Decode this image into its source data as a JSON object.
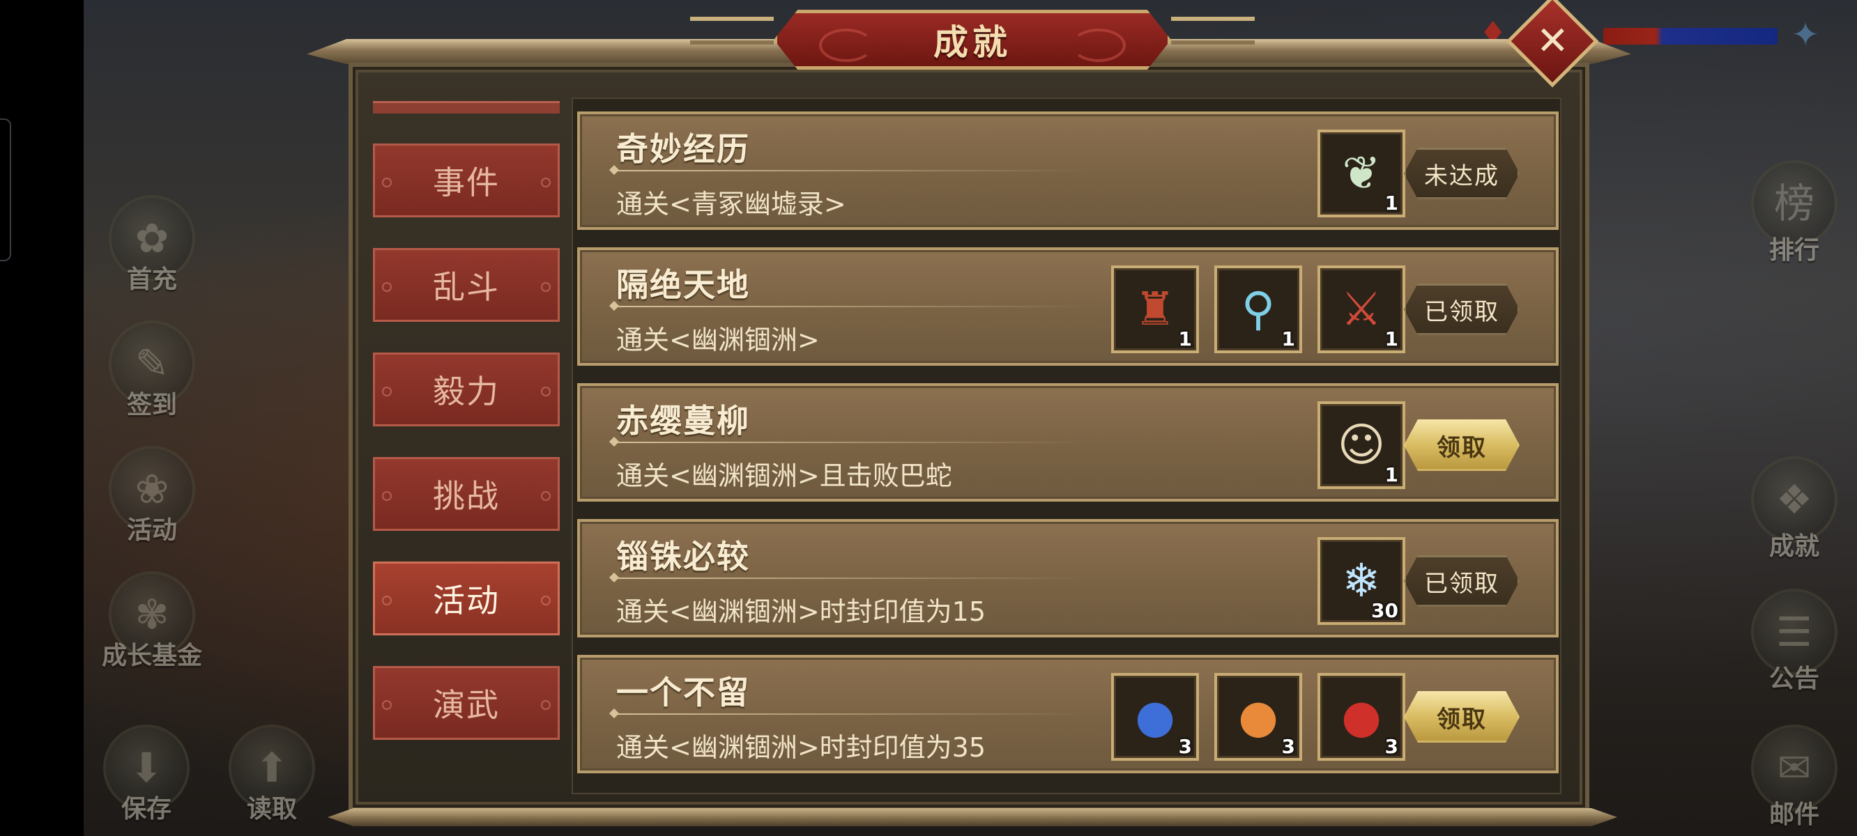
{
  "window": {
    "title": "成就",
    "close_glyph": "✕"
  },
  "hud": {
    "left": [
      {
        "label": "首充",
        "icon": "gift-icon",
        "glyph": "✿"
      },
      {
        "label": "签到",
        "icon": "scroll-icon",
        "glyph": "✎"
      },
      {
        "label": "活动",
        "icon": "festival-icon",
        "glyph": "❀"
      },
      {
        "label": "成长基金",
        "icon": "plant-icon",
        "glyph": "✾"
      }
    ],
    "bottom_left": [
      {
        "label": "保存",
        "icon": "save-icon",
        "glyph": "⬇"
      },
      {
        "label": "读取",
        "icon": "load-icon",
        "glyph": "⬆"
      }
    ],
    "right": [
      {
        "label": "排行",
        "icon": "ranking-icon",
        "glyph": "榜"
      },
      {
        "label": "成就",
        "icon": "achievement-icon",
        "glyph": "❖"
      },
      {
        "label": "公告",
        "icon": "notice-icon",
        "glyph": "☰"
      },
      {
        "label": "邮件",
        "icon": "mail-icon",
        "glyph": "✉"
      }
    ]
  },
  "tabs": [
    {
      "label": "事件",
      "active": false
    },
    {
      "label": "乱斗",
      "active": false
    },
    {
      "label": "毅力",
      "active": false
    },
    {
      "label": "挑战",
      "active": false
    },
    {
      "label": "活动",
      "active": true
    },
    {
      "label": "演武",
      "active": false
    }
  ],
  "achievements": [
    {
      "title": "奇妙经历",
      "desc": "通关<青冢幽墟录>",
      "rewards": [
        {
          "icon": "leaf-icon",
          "glyph": "❦",
          "color": "#cfe6c9",
          "count": "1"
        }
      ],
      "status": "未达成",
      "status_style": "dark"
    },
    {
      "title": "隔绝天地",
      "desc": "通关<幽渊锢洲>",
      "rewards": [
        {
          "icon": "armor-icon",
          "glyph": "♜",
          "color": "#c0492f",
          "count": "1"
        },
        {
          "icon": "mirror-icon",
          "glyph": "⚲",
          "color": "#7fd0e6",
          "count": "1"
        },
        {
          "icon": "spear-icon",
          "glyph": "⚔",
          "color": "#d04a3a",
          "count": "1"
        }
      ],
      "status": "已领取",
      "status_style": "dark"
    },
    {
      "title": "赤缨蔓柳",
      "desc": "通关<幽渊锢洲>且击败巴蛇",
      "rewards": [
        {
          "icon": "hero-portrait-icon",
          "glyph": "☺",
          "color": "#e8d9b8",
          "count": "1"
        }
      ],
      "status": "领取",
      "status_style": "gold"
    },
    {
      "title": "锱铢必较",
      "desc": "通关<幽渊锢洲>时封印值为15",
      "rewards": [
        {
          "icon": "ice-crystal-icon",
          "glyph": "❄",
          "color": "#bfe6ff",
          "count": "30"
        }
      ],
      "status": "已领取",
      "status_style": "dark"
    },
    {
      "title": "一个不留",
      "desc": "通关<幽渊锢洲>时封印值为35",
      "rewards": [
        {
          "icon": "blue-fruit-icon",
          "glyph": "●",
          "color": "#3e6ed8",
          "count": "3"
        },
        {
          "icon": "orange-fruit-icon",
          "glyph": "●",
          "color": "#e88a3a",
          "count": "3"
        },
        {
          "icon": "red-fruit-icon",
          "glyph": "●",
          "color": "#d0302a",
          "count": "3"
        }
      ],
      "status": "领取",
      "status_style": "gold"
    }
  ]
}
